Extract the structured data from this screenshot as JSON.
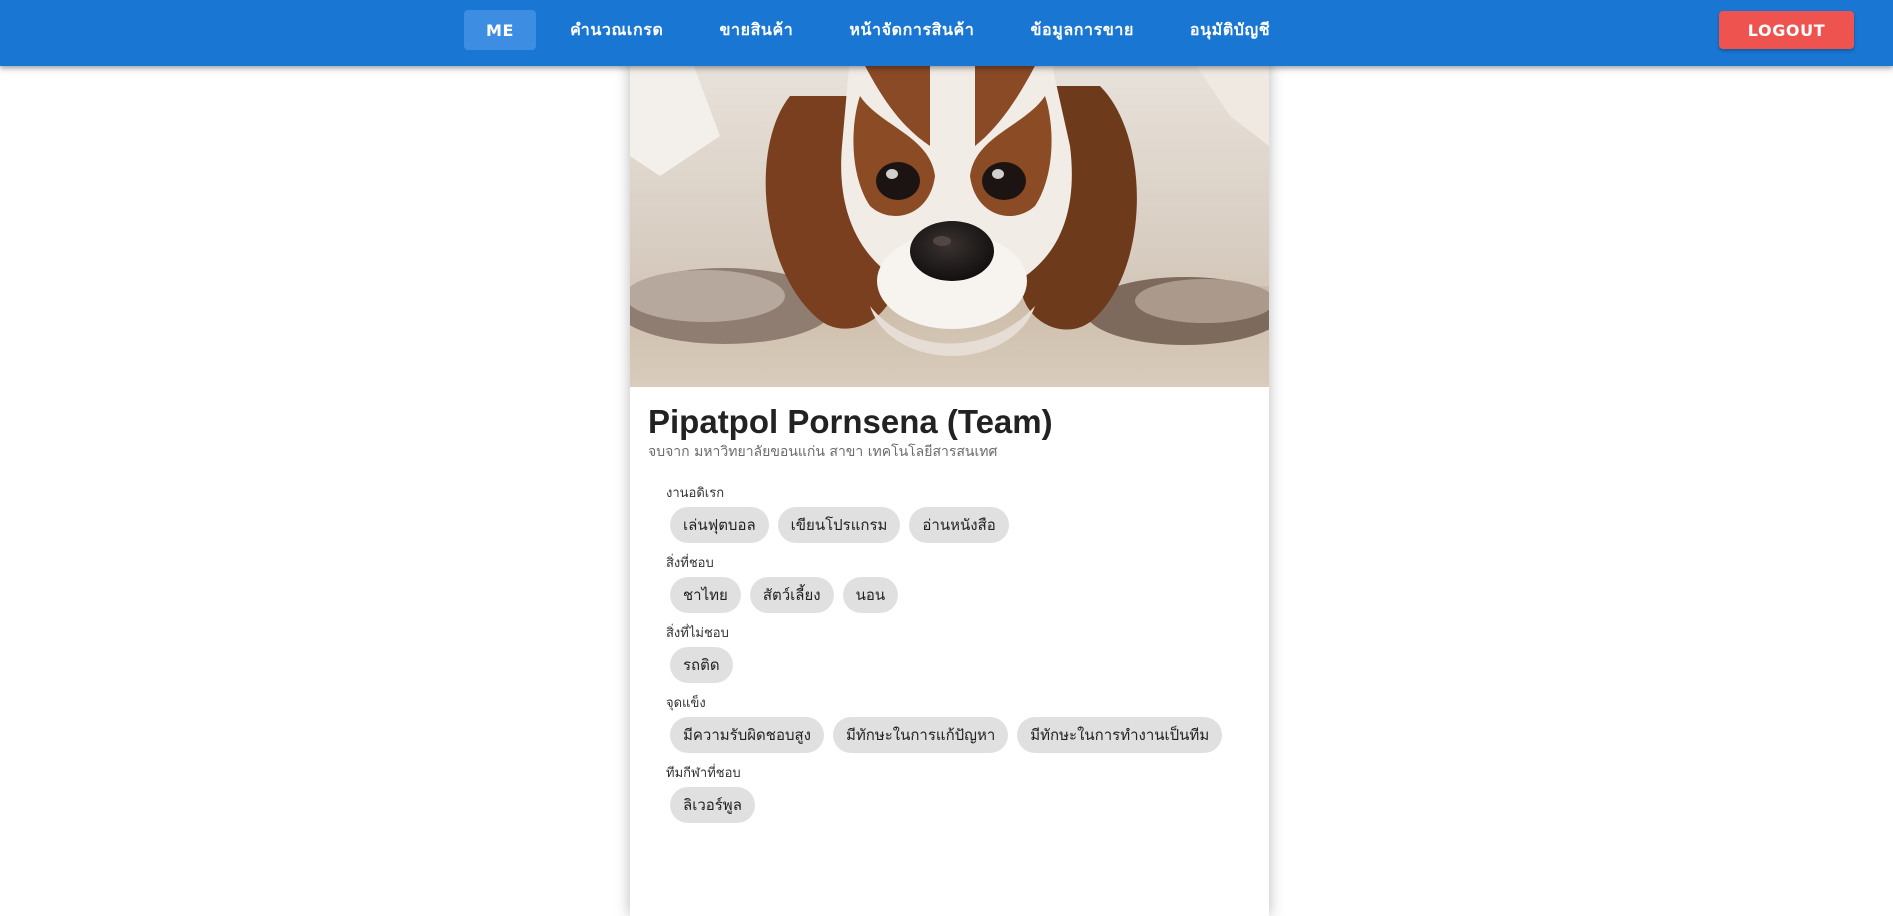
{
  "nav": {
    "items": [
      {
        "label": "ME"
      },
      {
        "label": "คำนวณเกรด"
      },
      {
        "label": "ขายสินค้า"
      },
      {
        "label": "หน้าจัดการสินค้า"
      },
      {
        "label": "ข้อมูลการขาย"
      },
      {
        "label": "อนุมัติบัญชี"
      }
    ],
    "logout_label": "LOGOUT"
  },
  "profile": {
    "name": "Pipatpol Pornsena (Team)",
    "education": "จบจาก มหาวิทยาลัยขอนแก่น สาขา เทคโนโลยีสารสนเทศ",
    "photo_alt": "Cavalier King Charles Spaniel puppy lying on carpet",
    "sections": [
      {
        "label": "งานอดิเรก",
        "chips": [
          "เล่นฟุตบอล",
          "เขียนโปรแกรม",
          "อ่านหนังสือ"
        ]
      },
      {
        "label": "สิ่งที่ชอบ",
        "chips": [
          "ชาไทย",
          "สัตว์เลี้ยง",
          "นอน"
        ]
      },
      {
        "label": "สิ่งที่ไม่ชอบ",
        "chips": [
          "รถติด"
        ]
      },
      {
        "label": "จุดแข็ง",
        "chips": [
          "มีความรับผิดชอบสูง",
          "มีทักษะในการแก้ปัญหา",
          "มีทักษะในการทำงานเป็นทีม"
        ]
      },
      {
        "label": "ทีมกีฬาที่ชอบ",
        "chips": [
          "ลิเวอร์พูล"
        ]
      }
    ]
  },
  "colors": {
    "appbar": "#1976d2",
    "active_nav": "#3d8ee3",
    "logout": "#ef5350",
    "chip": "#e0e0e0"
  }
}
